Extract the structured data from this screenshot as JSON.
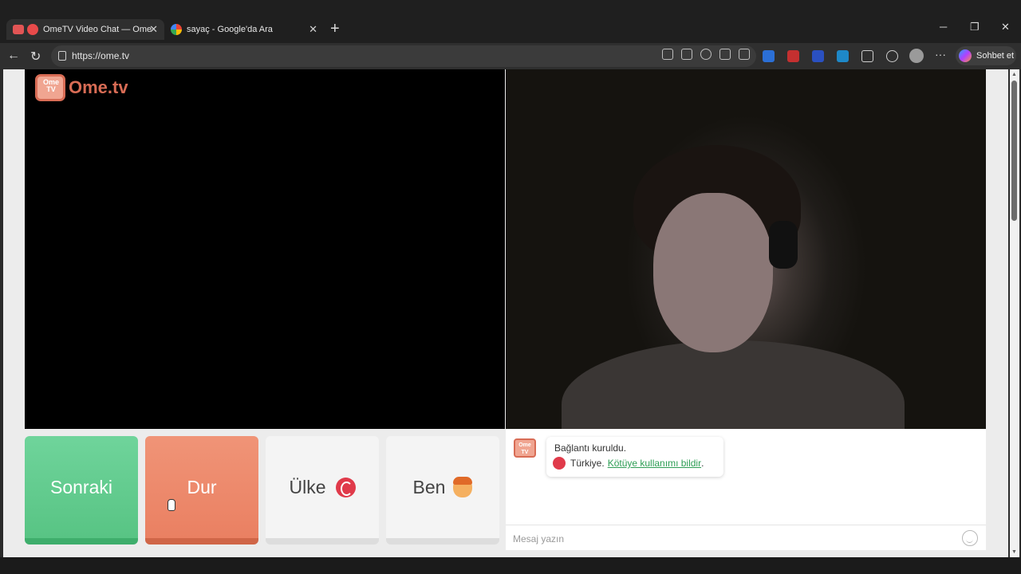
{
  "browser": {
    "tabs": [
      {
        "title": "OmeTV Video Chat — Omegle",
        "active": true
      },
      {
        "title": "sayaç - Google'da Ara",
        "active": false
      }
    ],
    "url": "https://ome.tv",
    "copilot_label": "Sohbet et",
    "icons": [
      "back-icon",
      "refresh-icon",
      "lock-icon",
      "new-tab-icon",
      "minimize-icon",
      "maximize-icon",
      "close-window-icon",
      "favorite-icon",
      "extensions-icon",
      "profile-icon",
      "more-icon"
    ]
  },
  "site": {
    "logo_tv_text": "Ome\nTV",
    "logo_word": "Ome.tv"
  },
  "controls": {
    "next_label": "Sonraki",
    "stop_label": "Dur",
    "country_label": "Ülke",
    "me_label": "Ben"
  },
  "chat": {
    "logo_text": "Ome TV",
    "system_message": "Bağlantı kuruldu.",
    "country_text": "Türkiye.",
    "report_link": "Kötüye kullanımı bildir",
    "report_suffix": ".",
    "input_placeholder": "Mesaj yazın"
  },
  "colors": {
    "next_green": "#58c484",
    "stop_orange": "#ea8062",
    "brand": "#d86c55",
    "link_green": "#2e9e55"
  }
}
